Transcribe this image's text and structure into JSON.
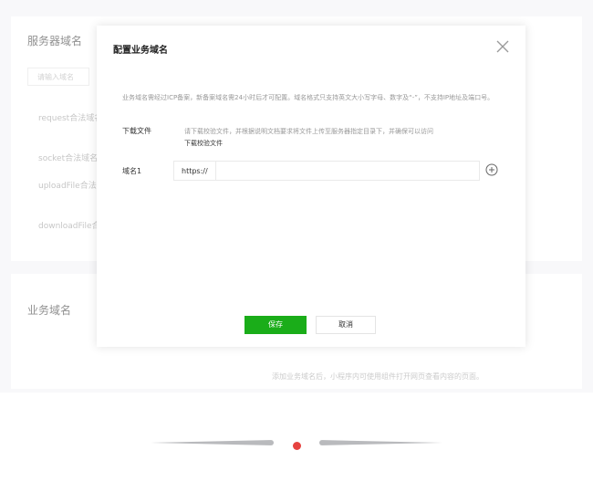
{
  "background": {
    "section1_title": "服务器域名",
    "search_placeholder": "请输入域名",
    "items": [
      "request合法域名",
      "socket合法域名",
      "uploadFile合法域名",
      "downloadFile合法域名"
    ],
    "section2_title": "业务域名",
    "section2_hint": "添加业务域名后，小程序内可使用组件打开网页查看内容的页面。"
  },
  "modal": {
    "title": "配置业务域名",
    "description": "业务域名需经过ICP备案，新备案域名需24小时后才可配置。域名格式只支持英文大小写字母、数字及“-”，不支持IP地址及端口号。",
    "download": {
      "label": "下载文件",
      "description": "请下载校验文件，并根据说明文档要求将文件上传至服务器指定目录下，并确保可以访问",
      "link_text": "下载校验文件"
    },
    "domain": {
      "label": "域名1",
      "prefix": "https://",
      "value": ""
    },
    "save_label": "保存",
    "cancel_label": "取消"
  },
  "pager": {
    "active_color": "#e64340"
  },
  "colors": {
    "primary": "#1aad19",
    "accent": "#e64340"
  }
}
